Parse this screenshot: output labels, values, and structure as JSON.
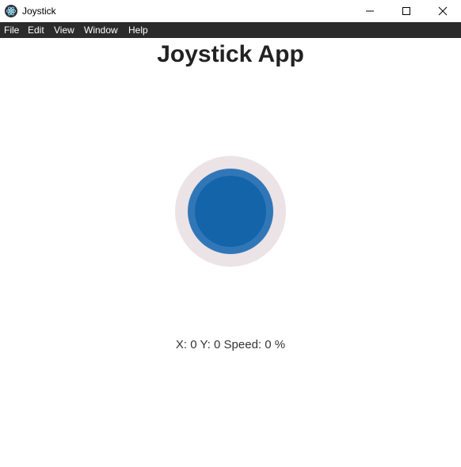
{
  "window": {
    "title": "Joystick"
  },
  "menu": {
    "items": [
      "File",
      "Edit",
      "View",
      "Window",
      "Help"
    ]
  },
  "page": {
    "heading": "Joystick App"
  },
  "status": {
    "x_label": "X:",
    "x_value": "0",
    "y_label": "Y:",
    "y_value": "0",
    "speed_label": "Speed:",
    "speed_value": "0",
    "speed_unit": "%"
  },
  "joystick": {
    "x": 0,
    "y": 0,
    "speed_percent": 0
  },
  "colors": {
    "base": "#ebe3e6",
    "knob_ring": "#3177b8",
    "knob": "#1464aa",
    "menubar": "#2b2b2b"
  }
}
